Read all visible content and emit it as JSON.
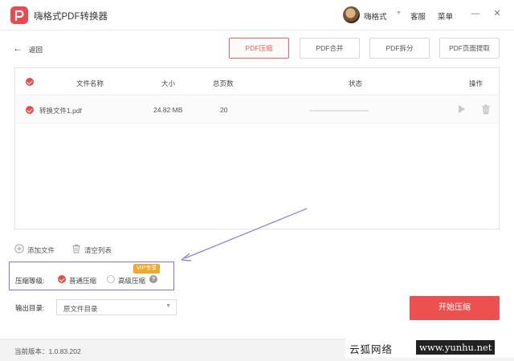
{
  "app": {
    "title": "嗨格式PDF转换器",
    "user_name": "嗨格式",
    "service_label": "客服",
    "menu_label": "菜单",
    "window_minimize": "—",
    "window_close": "✕"
  },
  "toolbar": {
    "back_label": "返回",
    "tabs": [
      {
        "label": "PDF压缩",
        "active": true
      },
      {
        "label": "PDF合并",
        "active": false
      },
      {
        "label": "PDF拆分",
        "active": false
      },
      {
        "label": "PDF页面提取",
        "active": false
      }
    ]
  },
  "table": {
    "columns": [
      "文件名称",
      "大小",
      "总页数",
      "状态",
      "操作"
    ],
    "rows": [
      {
        "name": "转换文件1.pdf",
        "size": "24.82 MB",
        "pages": "20",
        "progress": 0
      }
    ]
  },
  "actions": {
    "add_label": "添加文件",
    "clear_label": "清空列表"
  },
  "compression": {
    "label": "压缩等级:",
    "options": [
      {
        "label": "普通压缩",
        "selected": true
      },
      {
        "label": "高级压缩",
        "selected": false
      }
    ],
    "vip_badge": "VIP专享",
    "help_glyph": "?"
  },
  "output": {
    "label": "输出目录:",
    "value": "原文件目录"
  },
  "start_button": "开始压缩",
  "footer": {
    "version": "当前版本：1.0.83.202"
  },
  "watermark": {
    "text": "云狐网络",
    "url": "www.yunhu.net"
  },
  "colors": {
    "accent": "#ec5050",
    "annotation": "#7f78d8",
    "vip": "#f0a92d"
  }
}
